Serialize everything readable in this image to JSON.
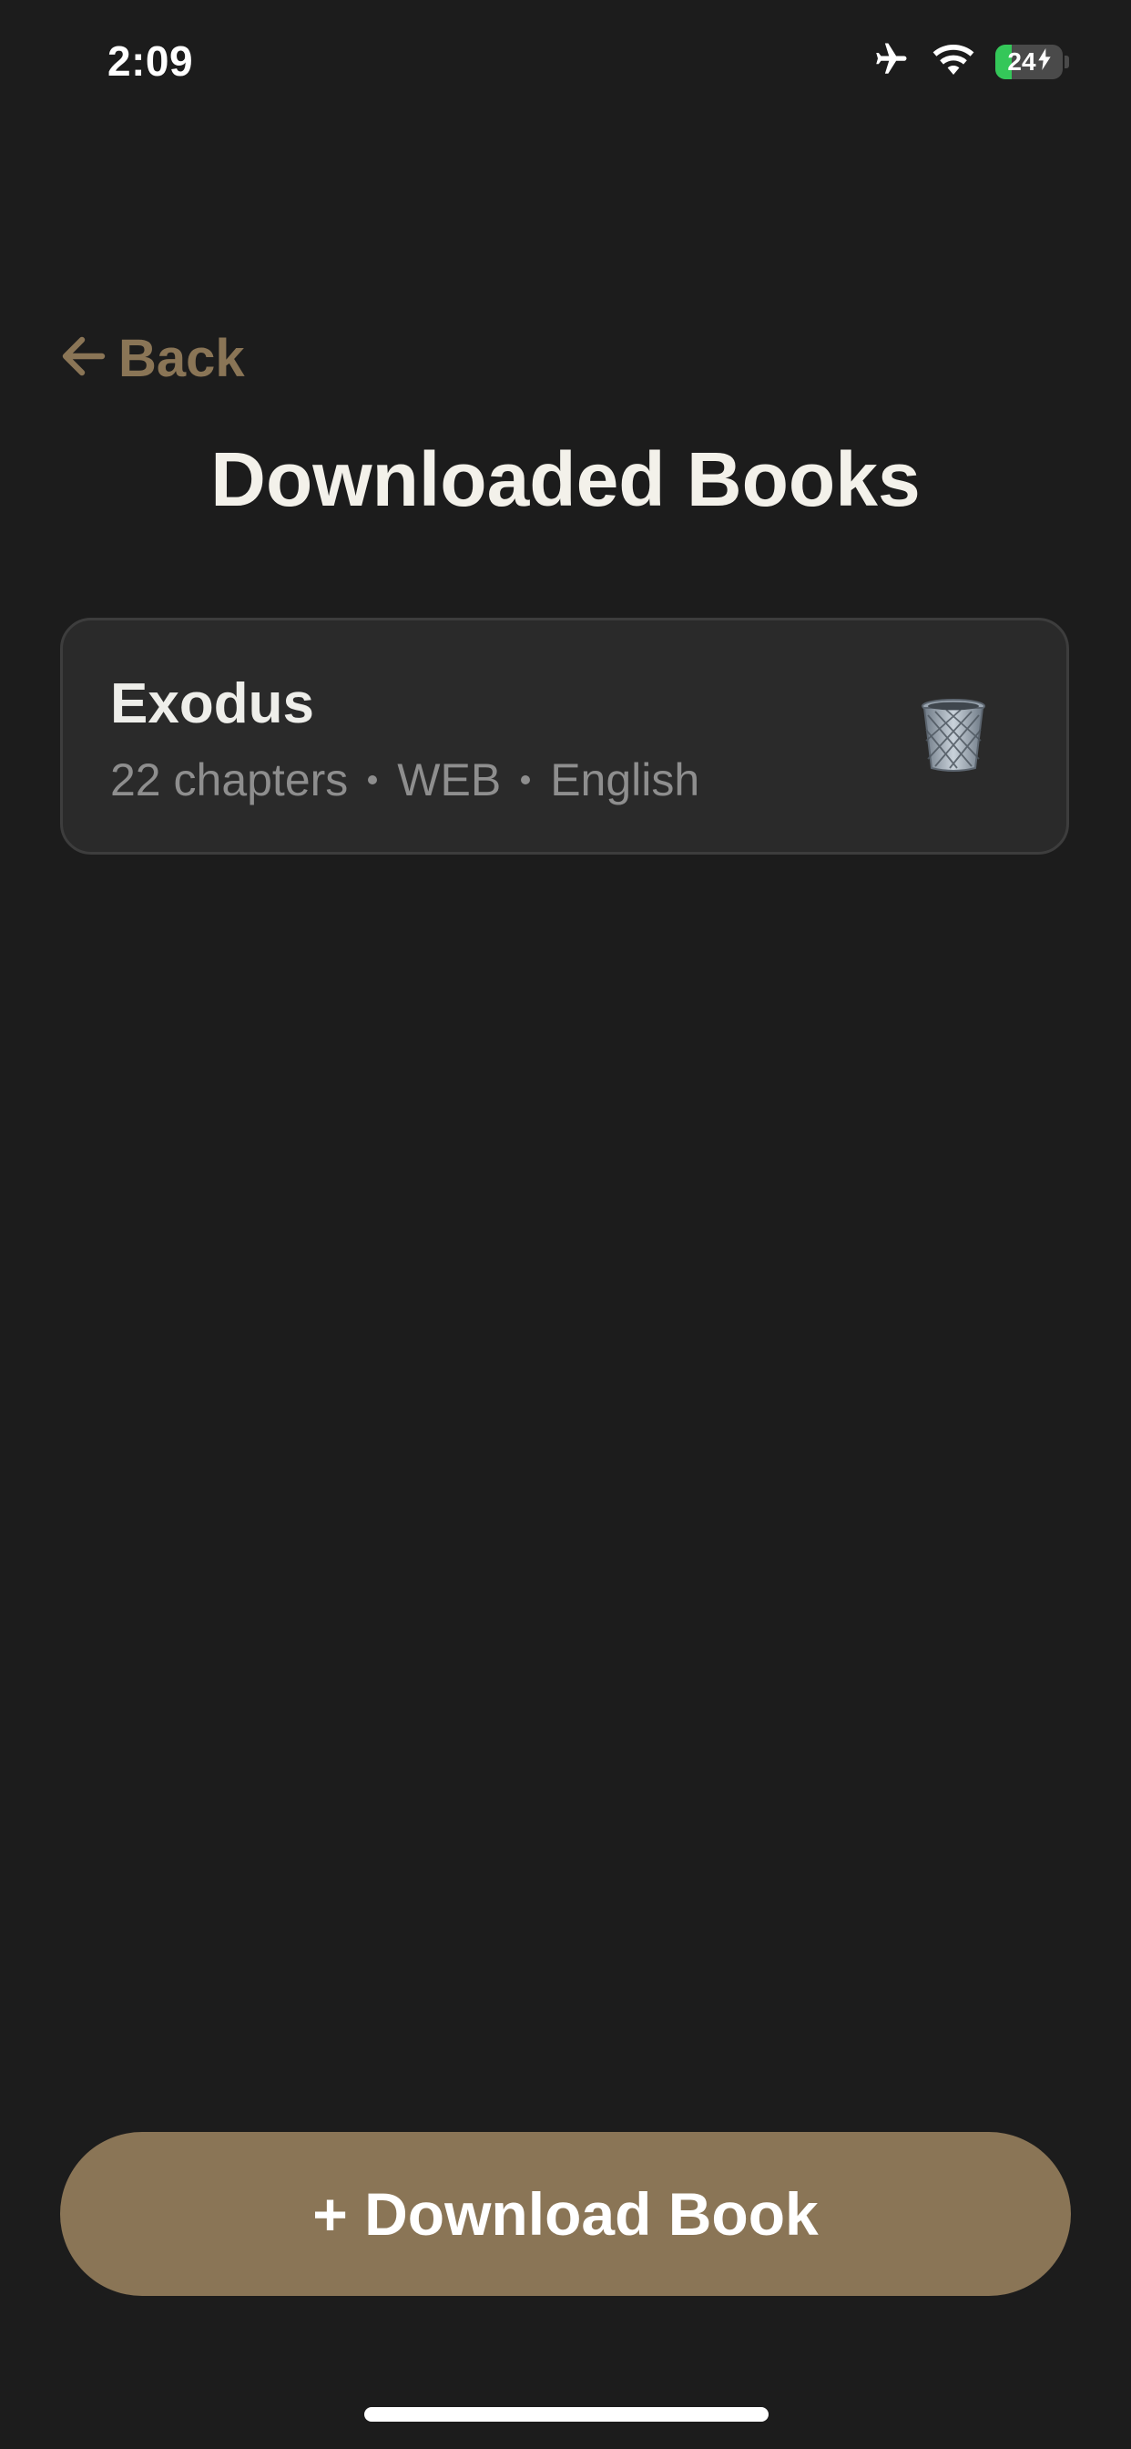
{
  "status_bar": {
    "time": "2:09",
    "battery_level": "24",
    "battery_fraction": 0.24,
    "icons": [
      "airplane-icon",
      "wifi-icon",
      "battery-charging-icon"
    ]
  },
  "header": {
    "back_label": "Back",
    "title": "Downloaded Books"
  },
  "books": [
    {
      "title": "Exodus",
      "chapters": "22 chapters",
      "translation": "WEB",
      "language": "English",
      "action_icon": "trash-icon"
    }
  ],
  "footer": {
    "download_label": "+ Download Book"
  },
  "colors": {
    "background": "#1c1c1c",
    "accent": "#8a7556",
    "card": "#2a2a2a",
    "battery_green": "#34c759"
  }
}
